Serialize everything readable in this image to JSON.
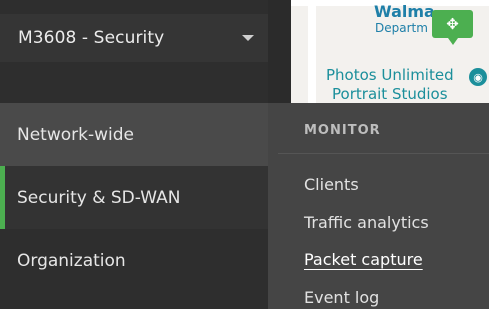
{
  "network_selector": {
    "label": "M3608 - Security"
  },
  "sidebar": {
    "items": [
      {
        "label": "Network-wide",
        "state": "hovered"
      },
      {
        "label": "Security & SD-WAN",
        "state": "active"
      },
      {
        "label": "Organization",
        "state": "normal"
      }
    ]
  },
  "colors": {
    "accent": "#4caf50"
  },
  "map": {
    "poi1": "Walma",
    "poi1_sub": "Departm",
    "poi2_line1": "Photos Unlimited",
    "poi2_line2": "Portrait Studios",
    "pin_icon": "move-arrows-icon",
    "camera_icon": "camera-icon"
  },
  "flyout": {
    "heading": "MONITOR",
    "items": [
      {
        "label": "Clients"
      },
      {
        "label": "Traffic analytics"
      },
      {
        "label": "Packet capture",
        "selected": true
      },
      {
        "label": "Event log"
      }
    ]
  }
}
